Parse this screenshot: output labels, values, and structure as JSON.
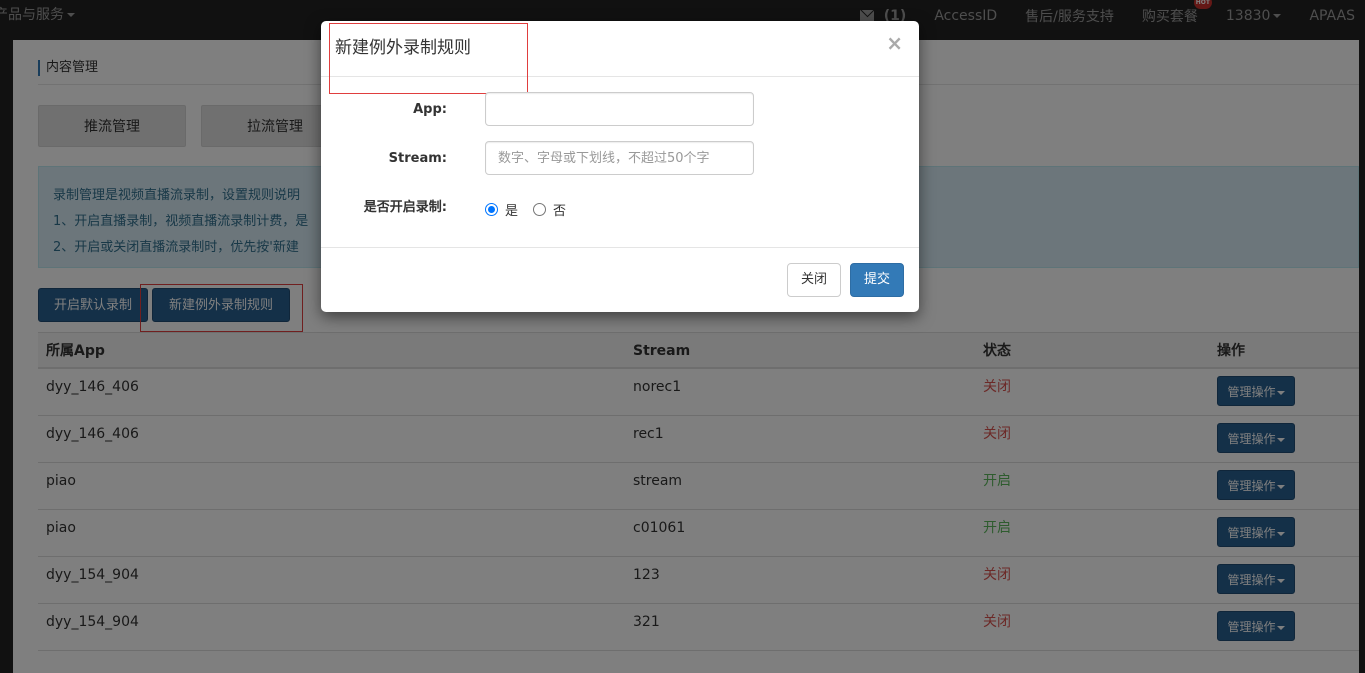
{
  "nav": {
    "products": "产品与服务",
    "messages_count": "(1)",
    "access_id": "AccessID",
    "support": "售后/服务支持",
    "buy": "购买套餐",
    "hot_badge": "HOT",
    "account": "13830",
    "apaas": "APAAS"
  },
  "page": {
    "section_title": "内容管理",
    "tabs": [
      "推流管理",
      "拉流管理"
    ],
    "info_lines": [
      "录制管理是视频直播流录制，设置规则说明",
      "1、开启直播录制，视频直播流录制计费，是",
      "2、开启或关闭直播流录制时，优先按'新建"
    ],
    "enable_default_button": "开启默认录制",
    "new_rule_button": "新建例外录制规则"
  },
  "table": {
    "headers": [
      "所属App",
      "Stream",
      "状态",
      "操作"
    ],
    "action_label": "管理操作",
    "rows": [
      {
        "app": "dyy_146_406",
        "stream": "norec1",
        "status": "关闭",
        "on": false
      },
      {
        "app": "dyy_146_406",
        "stream": "rec1",
        "status": "关闭",
        "on": false
      },
      {
        "app": "piao",
        "stream": "stream",
        "status": "开启",
        "on": true
      },
      {
        "app": "piao",
        "stream": "c01061",
        "status": "开启",
        "on": true
      },
      {
        "app": "dyy_154_904",
        "stream": "123",
        "status": "关闭",
        "on": false
      },
      {
        "app": "dyy_154_904",
        "stream": "321",
        "status": "关闭",
        "on": false
      }
    ]
  },
  "modal": {
    "title": "新建例外录制规则",
    "close_symbol": "×",
    "app_label": "App:",
    "app_value": "",
    "stream_label": "Stream:",
    "stream_placeholder": "数字、字母或下划线，不超过50个字",
    "record_label": "是否开启录制:",
    "options": [
      "是",
      "否"
    ],
    "selected_option": "是",
    "close_button": "关闭",
    "submit_button": "提交"
  },
  "colors": {
    "nav_bg": "#222222",
    "primary": "#337ab7",
    "primary_dark": "#286090",
    "status_off": "#d9534f",
    "status_on": "#5cb85c",
    "highlight_box": "#e03e3e"
  }
}
